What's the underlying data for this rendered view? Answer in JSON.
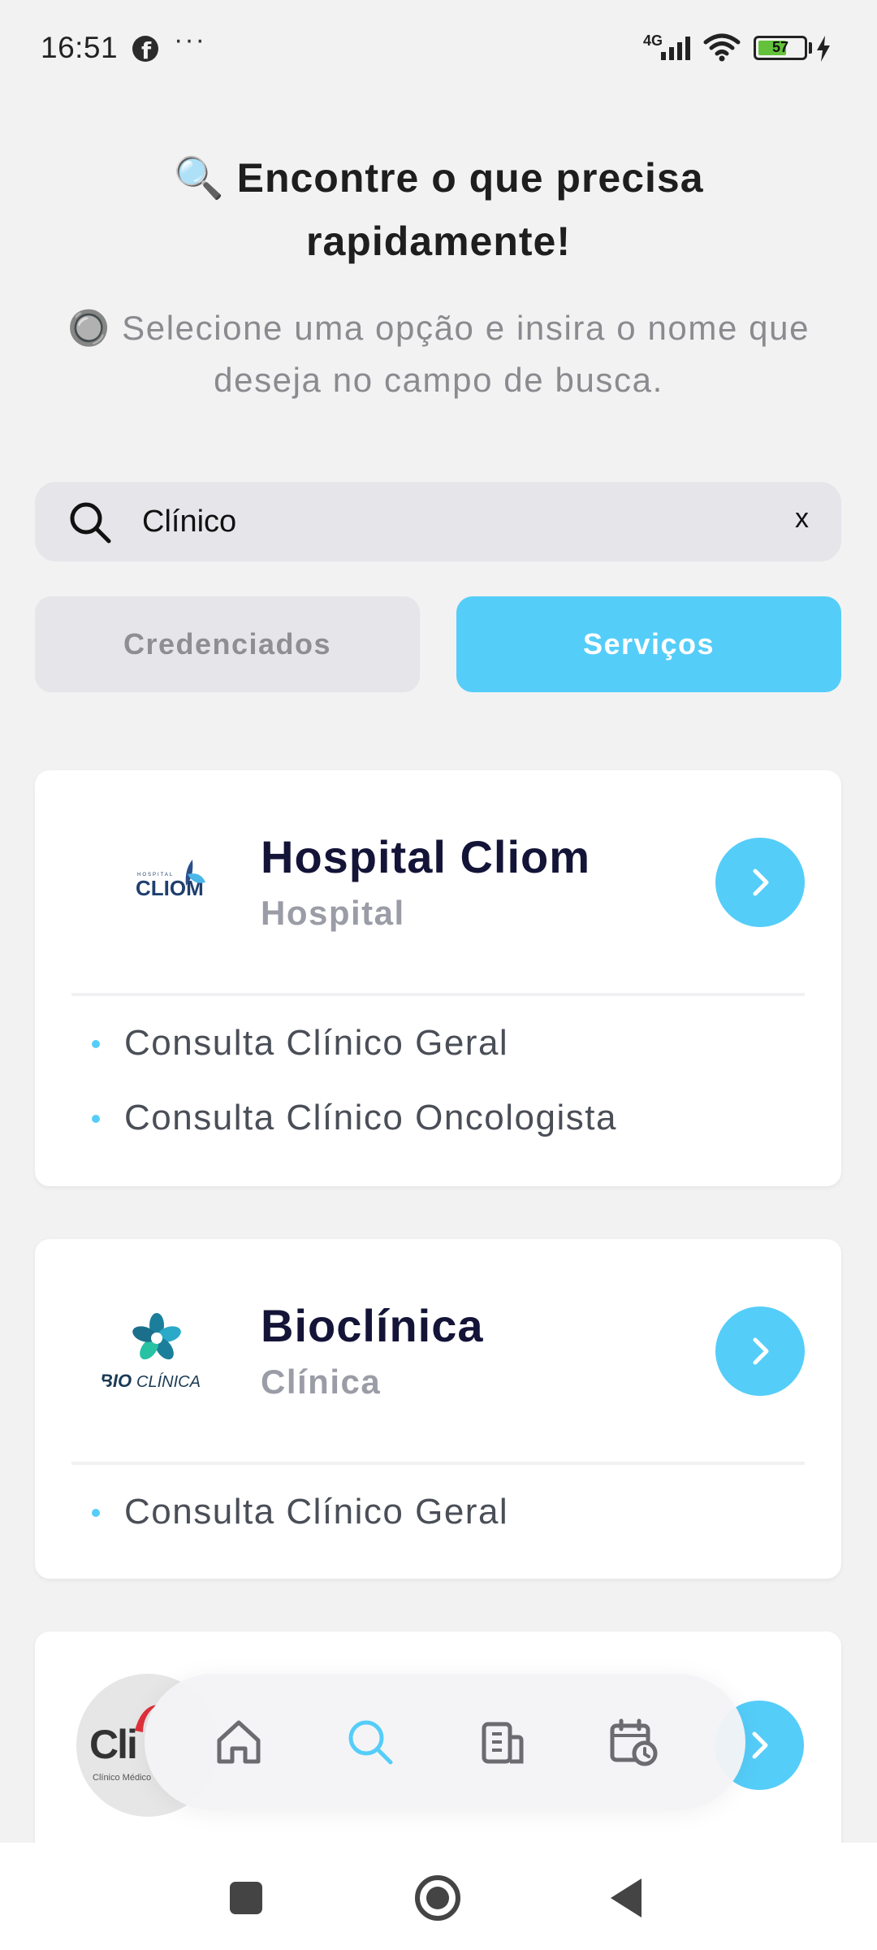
{
  "status_bar": {
    "time": "16:51",
    "network": "4G",
    "battery": "57",
    "icons": [
      "facebook-icon",
      "more-icon",
      "signal-icon",
      "wifi-icon",
      "battery-icon",
      "charging-icon"
    ]
  },
  "header": {
    "title_emoji": "🔍",
    "title": "Encontre o que precisa rapidamente!",
    "subtitle_emoji": "🔘",
    "subtitle": "Selecione uma opção e insira o nome que deseja no campo de busca."
  },
  "search": {
    "value": "Clínico",
    "placeholder": "",
    "clear_label": "x"
  },
  "filters": {
    "credenciados": "Credenciados",
    "servicos": "Serviços",
    "active": "servicos"
  },
  "results": [
    {
      "name": "Hospital Cliom",
      "type": "Hospital",
      "logo_small": "HOSPITAL",
      "logo_text": "CLIOM",
      "services": [
        "Consulta Clínico Geral",
        "Consulta Clínico Oncologista"
      ]
    },
    {
      "name": "Bioclínica",
      "type": "Clínica",
      "logo_bold": "BIO",
      "logo_thin": "CLÍNICA",
      "services": [
        "Consulta Clínico Geral"
      ]
    },
    {
      "logo_text": "Cli",
      "logo_sub": "Clínico Médico"
    }
  ],
  "tab_bar": {
    "items": [
      "home-icon",
      "search-icon",
      "building-icon",
      "calendar-clock-icon"
    ],
    "active": "search-icon"
  },
  "colors": {
    "accent": "#55cdf9",
    "background": "#f2f2f3",
    "card": "#ffffff",
    "title": "#141438",
    "muted": "#9a9ca6"
  }
}
